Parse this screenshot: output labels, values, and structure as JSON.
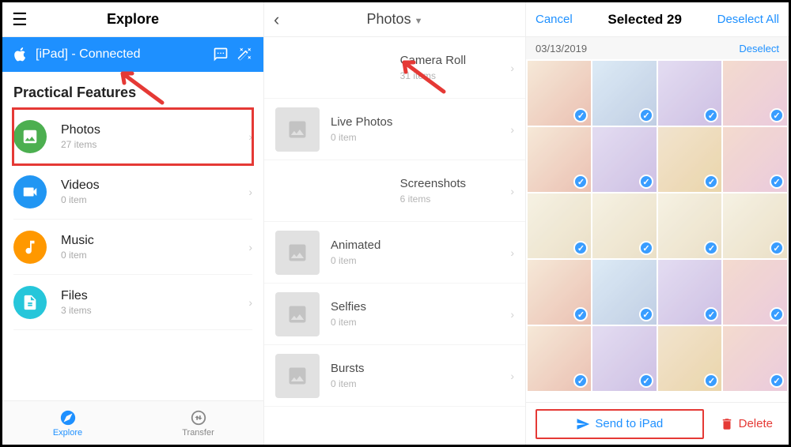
{
  "panel1": {
    "title": "Explore",
    "banner": {
      "device": "[iPad] - Connected"
    },
    "section": "Practical Features",
    "features": [
      {
        "name": "Photos",
        "sub": "27 items",
        "icon": "photos",
        "color": "green",
        "hl": true
      },
      {
        "name": "Videos",
        "sub": "0 item",
        "icon": "videos",
        "color": "blue"
      },
      {
        "name": "Music",
        "sub": "0 item",
        "icon": "music",
        "color": "orange"
      },
      {
        "name": "Files",
        "sub": "3 items",
        "icon": "files",
        "color": "teal"
      }
    ],
    "tabs": {
      "explore": "Explore",
      "transfer": "Transfer"
    }
  },
  "panel2": {
    "title": "Photos",
    "albums": [
      {
        "name": "Camera Roll",
        "sub": "31 items",
        "thumb": "grid"
      },
      {
        "name": "Live Photos",
        "sub": "0 item",
        "thumb": "placeholder"
      },
      {
        "name": "Screenshots",
        "sub": "6 items",
        "thumb": "grid"
      },
      {
        "name": "Animated",
        "sub": "0 item",
        "thumb": "placeholder"
      },
      {
        "name": "Selfies",
        "sub": "0 item",
        "thumb": "placeholder"
      },
      {
        "name": "Bursts",
        "sub": "0 item",
        "thumb": "placeholder"
      }
    ]
  },
  "panel3": {
    "cancel": "Cancel",
    "title": "Selected 29",
    "deselectAll": "Deselect All",
    "date": "03/13/2019",
    "deselect": "Deselect",
    "send": "Send to iPad",
    "delete": "Delete"
  }
}
